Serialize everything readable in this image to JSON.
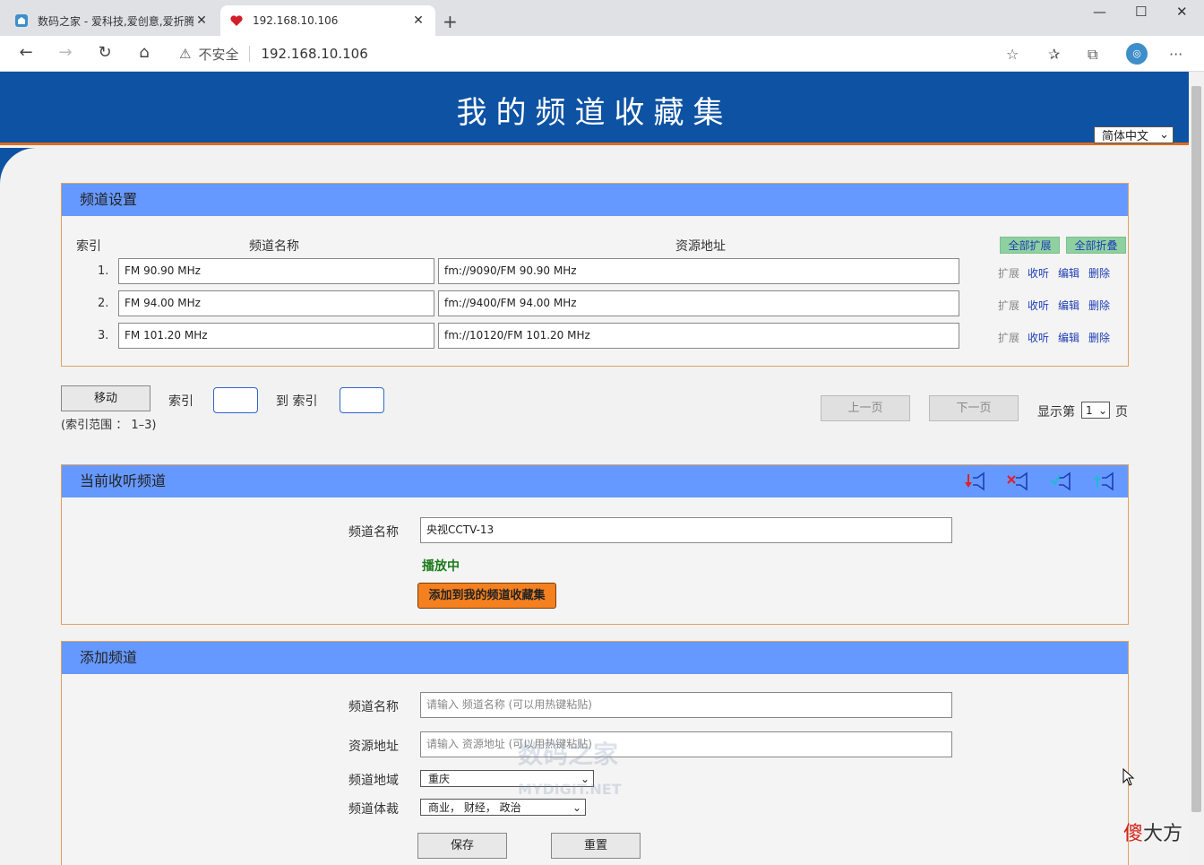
{
  "browser": {
    "tabs": [
      {
        "title": "数码之家 - 爱科技,爱创意,爱折腾",
        "active": false
      },
      {
        "title": "192.168.10.106",
        "active": true
      }
    ],
    "security_label": "不安全",
    "url": "192.168.10.106"
  },
  "header": {
    "title": "我的频道收藏集",
    "language": "简体中文"
  },
  "channel_settings": {
    "title": "频道设置",
    "col_index": "索引",
    "col_name": "频道名称",
    "col_url": "资源地址",
    "expand_all": "全部扩展",
    "collapse_all": "全部折叠",
    "rows": [
      {
        "index": "1.",
        "name": "FM 90.90 MHz",
        "url": "fm://9090/FM 90.90 MHz"
      },
      {
        "index": "2.",
        "name": "FM 94.00 MHz",
        "url": "fm://9400/FM 94.00 MHz"
      },
      {
        "index": "3.",
        "name": "FM 101.20 MHz",
        "url": "fm://10120/FM 101.20 MHz"
      }
    ],
    "actions": {
      "expand": "扩展",
      "listen": "收听",
      "edit": "编辑",
      "delete": "删除"
    }
  },
  "move": {
    "button": "移动",
    "index_label": "索引",
    "to_label": "到 索引",
    "range_note": "(索引范围 ： 1–3)"
  },
  "pagination": {
    "prev": "上一页",
    "next": "下一页",
    "show_label": "显示第",
    "page_value": "1",
    "page_suffix": "页"
  },
  "now_playing": {
    "title": "当前收听频道",
    "name_label": "频道名称",
    "name_value": "央视CCTV-13",
    "status": "播放中",
    "add_button": "添加到我的频道收藏集"
  },
  "add_channel": {
    "title": "添加频道",
    "name_label": "频道名称",
    "name_placeholder": "请输入 频道名称 (可以用热键粘贴)",
    "url_label": "资源地址",
    "url_placeholder": "请输入 资源地址 (可以用热键粘贴)",
    "region_label": "频道地域",
    "region_value": "重庆",
    "genre_label": "频道体裁",
    "genre_value": "商业， 财经， 政治",
    "save": "保存",
    "reset": "重置"
  },
  "watermark": {
    "site": "数码之家",
    "site_en": "MYDIGIT.NET",
    "author_a": "傻",
    "author_b": "大方"
  },
  "colors": {
    "header_bg": "#0d52a3",
    "panel_head": "#6699ff",
    "accent_orange": "#f4801f",
    "playing_green": "#1b7a1b",
    "link_blue": "#1e3db3"
  }
}
